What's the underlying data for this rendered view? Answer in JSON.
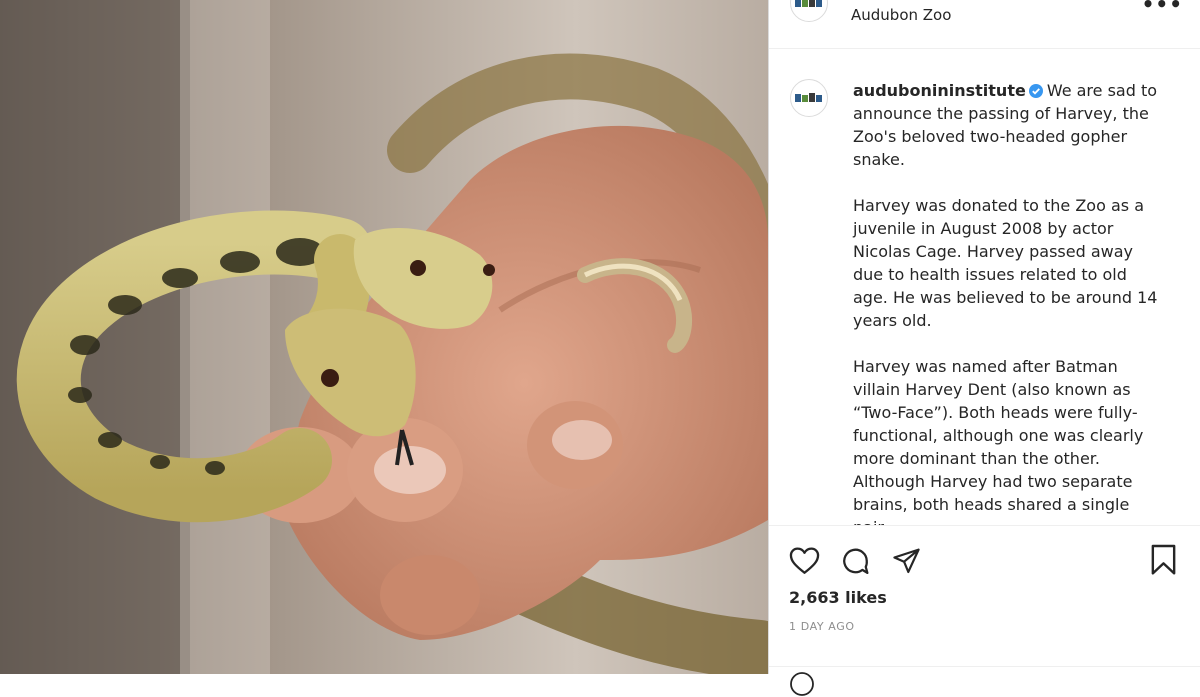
{
  "header": {
    "location": "Audubon Zoo",
    "avatar_icon": "audubon-logo-icon",
    "more_icon": "more-options-icon"
  },
  "post": {
    "username": "audubonininstitute",
    "verified": true,
    "caption_paragraphs": [
      "We are sad to announce the passing of Harvey, the Zoo's beloved two-headed gopher snake.",
      "Harvey was donated to the Zoo as a juvenile in August 2008 by actor Nicolas Cage. Harvey passed away due to health issues related to old age. He was believed to be around 14 years old.",
      "Harvey was named after Batman villain Harvey Dent (also known as “Two-Face”). Both heads were fully-functional, although one was clearly more dominant than the other. Although Harvey had two separate brains, both heads shared a single pair"
    ]
  },
  "actions": {
    "like_icon": "heart-icon",
    "comment_icon": "comment-icon",
    "share_icon": "share-icon",
    "save_icon": "bookmark-icon",
    "likes": "2,663 likes",
    "time": "1 DAY AGO"
  },
  "colors": {
    "text": "#262626",
    "muted": "#8e8e8e",
    "verified": "#3897f0",
    "border": "#dbdbdb"
  }
}
